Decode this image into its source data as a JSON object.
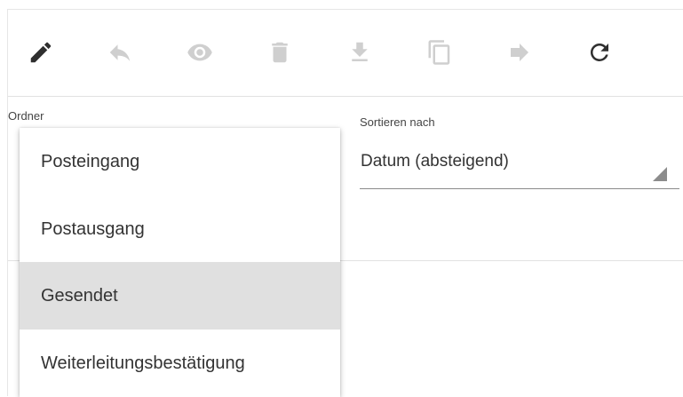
{
  "toolbar": {
    "buttons": [
      {
        "icon": "pencil-icon",
        "state": "enabled"
      },
      {
        "icon": "reply-icon",
        "state": "disabled"
      },
      {
        "icon": "eye-icon",
        "state": "disabled"
      },
      {
        "icon": "trash-icon",
        "state": "disabled"
      },
      {
        "icon": "download-icon",
        "state": "disabled"
      },
      {
        "icon": "copy-icon",
        "state": "disabled"
      },
      {
        "icon": "forward-arrow-icon",
        "state": "disabled"
      },
      {
        "icon": "refresh-icon",
        "state": "enabled"
      }
    ]
  },
  "folder": {
    "label": "Ordner",
    "options": [
      "Posteingang",
      "Postausgang",
      "Gesendet",
      "Weiterleitungsbestätigung"
    ],
    "highlighted": "Gesendet"
  },
  "sort": {
    "label": "Sortieren nach",
    "value": "Datum (absteigend)"
  },
  "colors": {
    "icon_enabled": "#2f2f2f",
    "icon_disabled": "#cfcfcf",
    "highlight": "#e0e0e0",
    "divider": "#e2e2e2"
  }
}
